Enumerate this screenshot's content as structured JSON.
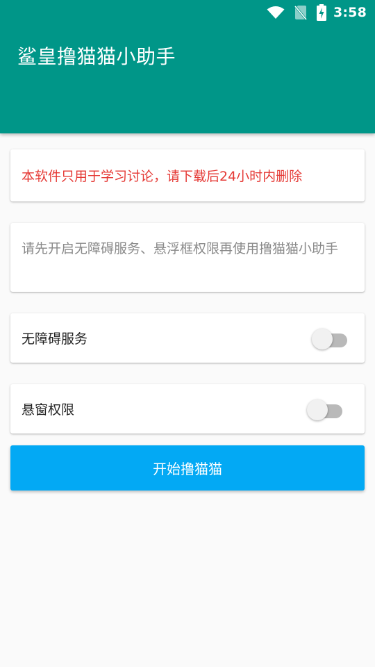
{
  "status_bar": {
    "time": "3:58",
    "icons": [
      "wifi-icon",
      "no-sim-icon",
      "battery-charging-icon"
    ]
  },
  "app_bar": {
    "title": "鲨皇撸猫猫小助手",
    "color": "#009688"
  },
  "warning": {
    "text": "本软件只用于学习讨论，请下载后24小时内删除",
    "color": "#e53935"
  },
  "hint": {
    "text": "请先开启无障碍服务、悬浮框权限再使用撸猫猫小助手"
  },
  "settings": [
    {
      "label": "无障碍服务",
      "enabled": false
    },
    {
      "label": "悬窗权限",
      "enabled": false
    }
  ],
  "start_button": {
    "label": "开始撸猫猫",
    "color": "#03a9f4"
  }
}
